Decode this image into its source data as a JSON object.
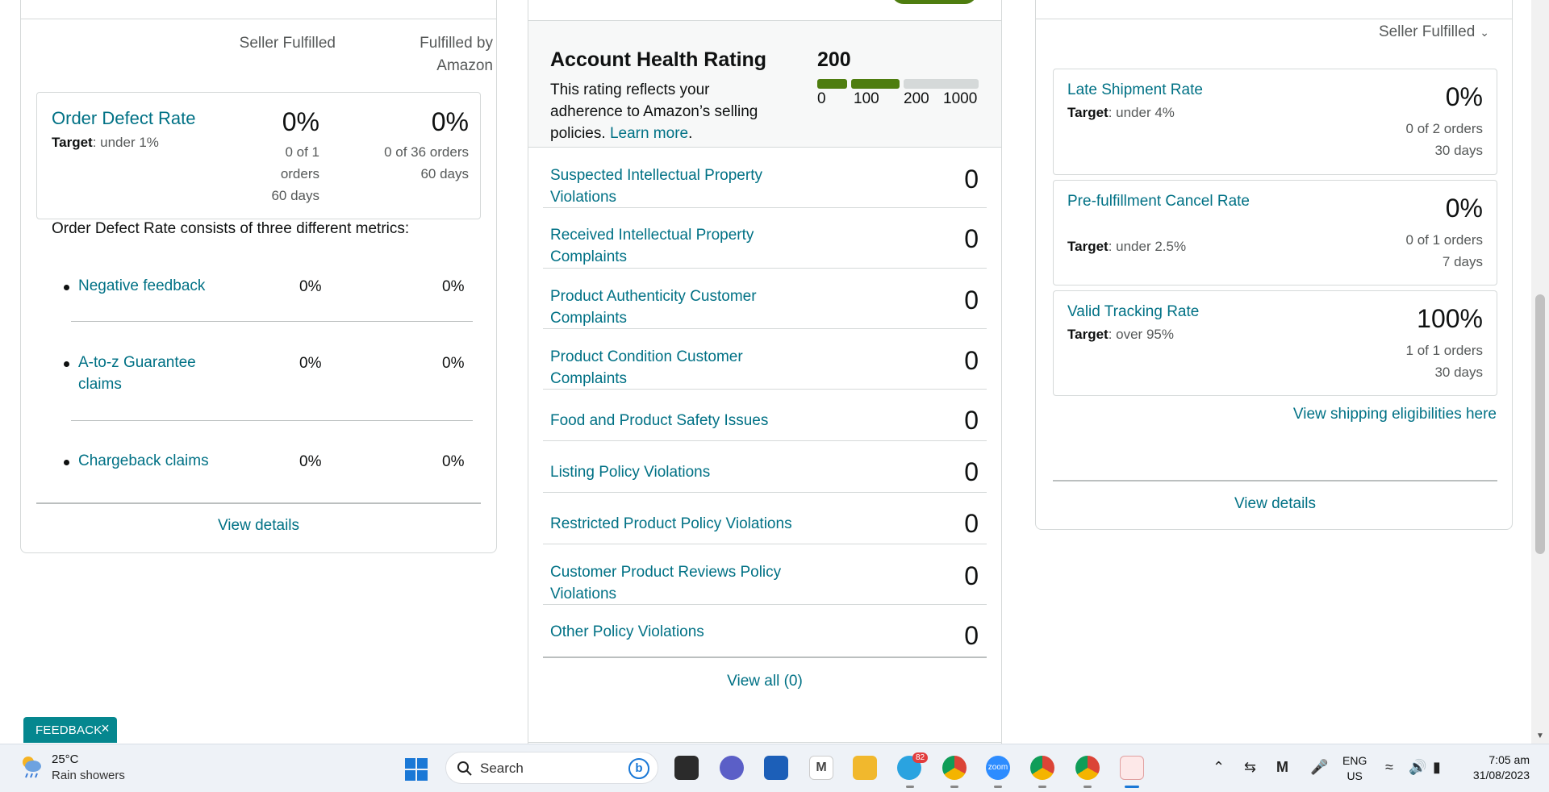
{
  "order_defect": {
    "col_seller": "Seller Fulfilled",
    "col_fba_1": "Fulfilled by",
    "col_fba_2": "Amazon",
    "odr_title": "Order Defect Rate",
    "odr_target_label": "Target",
    "odr_target_value": ": under 1%",
    "seller_pct": "0%",
    "seller_sub_1": "0 of 1",
    "seller_sub_2": "orders",
    "seller_sub_3": "60 days",
    "fba_pct": "0%",
    "fba_sub_1": "0 of 36 orders",
    "fba_sub_2": "60 days",
    "note": "Order Defect Rate consists of three different metrics:",
    "metrics": [
      {
        "name": "Negative feedback",
        "seller": "0%",
        "fba": "0%"
      },
      {
        "name_1": "A-to-z Guarantee",
        "name_2": "claims",
        "seller": "0%",
        "fba": "0%"
      },
      {
        "name": "Chargeback claims",
        "seller": "0%",
        "fba": "0%"
      }
    ],
    "view_details": "View details"
  },
  "account_health": {
    "title": "Account Health Rating",
    "score": "200",
    "desc_1": "This rating reflects your",
    "desc_2": "adherence to Amazon’s selling",
    "desc_3": "policies.",
    "learn_more": "Learn more",
    "desc_end": ".",
    "scale": [
      "0",
      "100",
      "200",
      "1000"
    ],
    "rating_value": 200,
    "colors": {
      "good": "#4e7d0f",
      "empty": "#d5d9d9"
    },
    "violations": [
      {
        "name": "Suspected Intellectual Property Violations",
        "count": "0"
      },
      {
        "name": "Received Intellectual Property Complaints",
        "count": "0"
      },
      {
        "name": "Product Authenticity Customer Complaints",
        "count": "0"
      },
      {
        "name": "Product Condition Customer Complaints",
        "count": "0"
      },
      {
        "name": "Food and Product Safety Issues",
        "count": "0"
      },
      {
        "name": "Listing Policy Violations",
        "count": "0"
      },
      {
        "name": "Restricted Product Policy Violations",
        "count": "0"
      },
      {
        "name": "Customer Product Reviews Policy Violations",
        "count": "0"
      },
      {
        "name": "Other Policy Violations",
        "count": "0"
      }
    ],
    "view_all": "View all (0)"
  },
  "shipping": {
    "selector": "Seller Fulfilled",
    "metrics": [
      {
        "title": "Late Shipment Rate",
        "target_label": "Target",
        "target_value": ": under 4%",
        "pct": "0%",
        "sub_1": "0 of 2 orders",
        "sub_2": "30 days"
      },
      {
        "title": "Pre-fulfillment Cancel Rate",
        "target_label": "Target",
        "target_value": ": under 2.5%",
        "pct": "0%",
        "sub_1": "0 of 1 orders",
        "sub_2": "7 days"
      },
      {
        "title": "Valid Tracking Rate",
        "target_label": "Target",
        "target_value": ": over 95%",
        "pct": "100%",
        "sub_1": "1 of 1 orders",
        "sub_2": "30 days"
      }
    ],
    "eligibility_link": "View shipping eligibilities here",
    "view_details": "View details"
  },
  "feedback": {
    "label": "FEEDBACK",
    "close": "×"
  },
  "taskbar": {
    "temp": "25°C",
    "condition": "Rain showers",
    "search": "Search",
    "telegram_badge": "82",
    "zoom_label": "zoom",
    "lang_1": "ENG",
    "lang_2": "US",
    "time": "7:05 am",
    "date": "31/08/2023"
  }
}
